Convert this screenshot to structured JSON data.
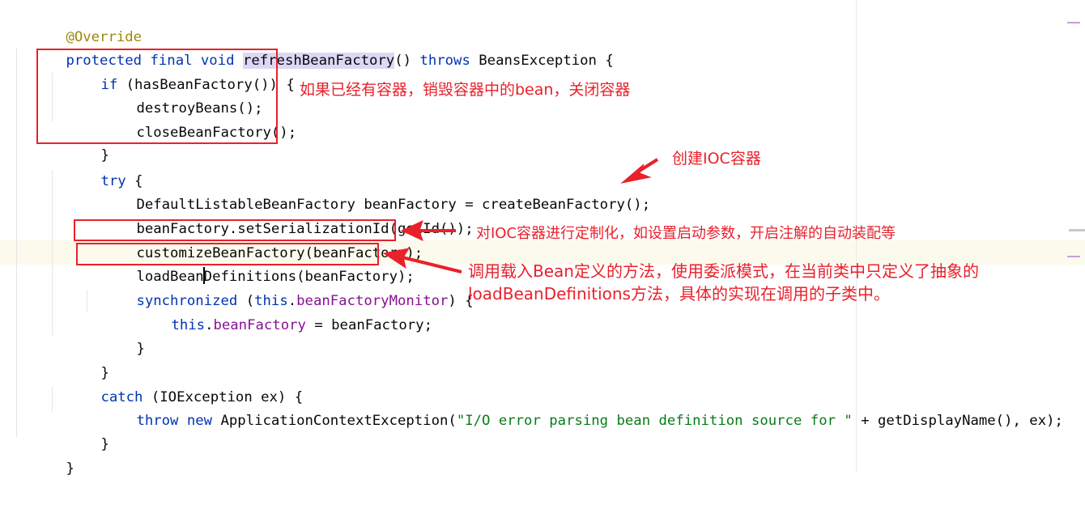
{
  "code": {
    "lines": {
      "l0": {
        "ann": "@Override"
      },
      "l1": {
        "kw1": "protected final void ",
        "method": "refreshBeanFactory",
        "t1": "() ",
        "kw2": "throws",
        "t2": " BeansException {"
      },
      "l2": {
        "kw": "if",
        "t": " (hasBeanFactory()) {"
      },
      "l3": {
        "t": "destroyBeans();"
      },
      "l4": {
        "t": "closeBeanFactory();"
      },
      "l5": {
        "t": "}"
      },
      "l6": {
        "kw": "try",
        "t": " {"
      },
      "l7": {
        "t1": "DefaultListableBeanFactory",
        "t2": " beanFactory = createBeanFactory();"
      },
      "l8": {
        "t": "beanFactory.setSerializationId(getId());"
      },
      "l9": {
        "t": "customizeBeanFactory(beanFactory);"
      },
      "l10": {
        "t1": "loadBean",
        "t2": "Definitions(beanFactory);"
      },
      "l11": {
        "kw": "synchronized",
        "t1": " (",
        "kw2": "this",
        "t2": ".",
        "fld": "beanFactoryMonitor",
        "t3": ") {"
      },
      "l12": {
        "kw": "this",
        "t1": ".",
        "fld": "beanFactory",
        "t2": " = beanFactory;"
      },
      "l13": {
        "t": "}"
      },
      "l14": {
        "t": "}"
      },
      "l15": {
        "kw": "catch",
        "t": " (IOException ex) {"
      },
      "l16": {
        "kw": "throw new",
        "t1": " ApplicationContextException(",
        "str": "\"I/O error parsing bean definition source for \"",
        "t2": " + getDisplayName(), ex);"
      },
      "l17": {
        "t": "}"
      },
      "l18": {
        "t": "}"
      }
    }
  },
  "annotations": {
    "note1": "如果已经有容器，销毁容器中的bean，关闭容器",
    "note2": "创建IOC容器",
    "note3": "对IOC容器进行定制化，如设置启动参数，开启注解的自动装配等",
    "note4_line1": "调用载入Bean定义的方法，使用委派模式，在当前类中只定义了抽象的",
    "note4_line2": "loadBeanDefinitions方法，具体的实现在调用的子类中。",
    "color": "#e8212b"
  },
  "theme": {
    "keyword": "#0033b3",
    "annotation": "#9e880d",
    "field": "#871094",
    "string": "#067d17",
    "current_line": "#fcfaed"
  }
}
